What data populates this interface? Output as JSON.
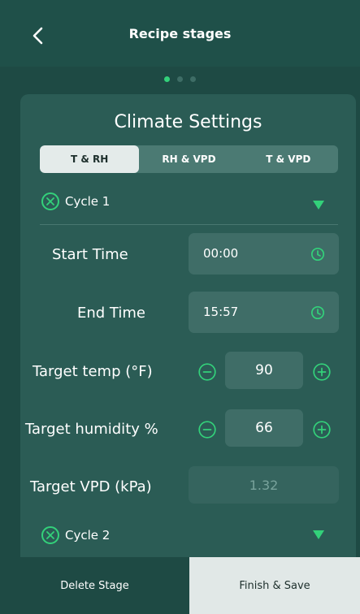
{
  "header": {
    "title": "Recipe stages"
  },
  "pager": {
    "total": 3,
    "active_index": 0
  },
  "card": {
    "title": "Climate Settings"
  },
  "mode_tabs": [
    {
      "label": "T & RH",
      "active": true
    },
    {
      "label": "RH & VPD",
      "active": false
    },
    {
      "label": "T & VPD",
      "active": false
    }
  ],
  "cycle1": {
    "label": "Cycle 1",
    "start_time": {
      "label": "Start Time",
      "value": "00:00"
    },
    "end_time": {
      "label": "End Time",
      "value": "15:57"
    },
    "target_temp": {
      "label": "Target temp (°F)",
      "value": "90"
    },
    "target_humidity": {
      "label": "Target humidity %",
      "value": "66"
    },
    "target_vpd": {
      "label": "Target VPD (kPa)",
      "value": "1.32"
    }
  },
  "cycle2": {
    "label": "Cycle 2"
  },
  "footer": {
    "delete_label": "Delete Stage",
    "save_label": "Finish & Save"
  },
  "colors": {
    "accent": "#33d17a",
    "background": "#1e4a44",
    "card": "#2b5c55",
    "input": "#3f6d67"
  }
}
